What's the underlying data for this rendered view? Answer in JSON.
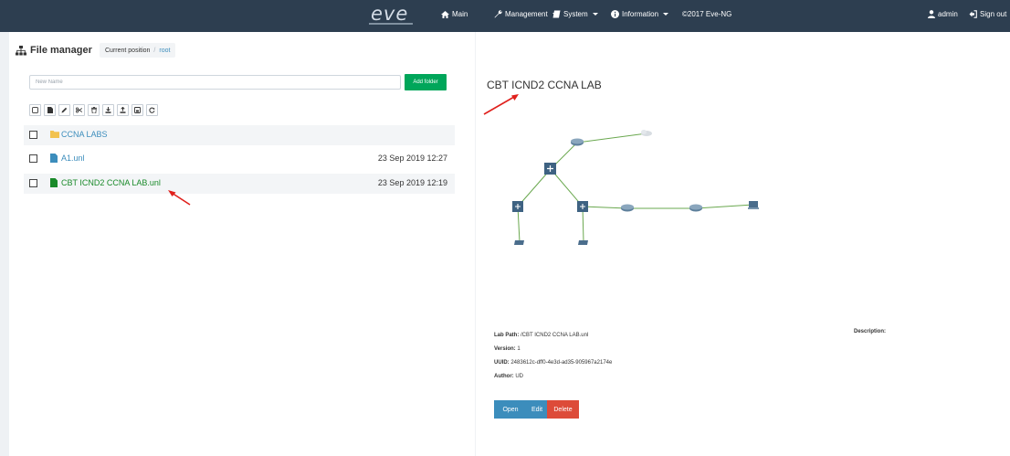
{
  "navbar": {
    "logo_text": "eve",
    "items": [
      {
        "label": "Main",
        "icon": "home-icon"
      },
      {
        "label": "Management",
        "icon": "wrench-icon"
      },
      {
        "label": "System",
        "icon": "book-icon"
      },
      {
        "label": "Information",
        "icon": "info-icon"
      },
      {
        "label": "©2017 Eve-NG"
      }
    ],
    "user": {
      "label": "admin",
      "icon": "user-icon"
    },
    "signout": {
      "label": "Sign out",
      "icon": "signout-icon"
    },
    "colors": {
      "background": "#2d3e50",
      "text": "#ffffff"
    }
  },
  "file_manager": {
    "title": "File manager",
    "icon": "sitemap-icon",
    "breadcrumb": {
      "label": "Current position",
      "separator": "/",
      "root": "root"
    },
    "new_name_placeholder": "New Name",
    "add_folder_label": "Add folder",
    "toolbar_icons": [
      "select-all-icon",
      "new-file-icon",
      "rename-icon",
      "cut-icon",
      "delete-icon",
      "import-icon",
      "export-icon",
      "save-icon",
      "refresh-icon"
    ],
    "items": [
      {
        "type": "folder",
        "name": "CCNA LABS",
        "date": "",
        "icon": "folder-icon"
      },
      {
        "type": "file",
        "name": "A1.unl",
        "date": "23 Sep 2019 12:27",
        "icon": "file-icon"
      },
      {
        "type": "file",
        "name": "CBT ICND2 CCNA LAB.unl",
        "date": "23 Sep 2019 12:19",
        "icon": "file-icon",
        "selected": true
      }
    ]
  },
  "lab": {
    "title": "CBT ICND2 CCNA LAB",
    "path_label": "Lab Path:",
    "path": "/CBT ICND2 CCNA LAB.unl",
    "version_label": "Version:",
    "version": "1",
    "uuid_label": "UUID:",
    "uuid": "2483612c-dff0-4e3d-ad35-905967a2174e",
    "author_label": "Author:",
    "author": "UD",
    "description_label": "Description:",
    "buttons": {
      "open": "Open",
      "edit": "Edit",
      "delete": "Delete"
    }
  },
  "colors": {
    "accent": "#3c8dbc",
    "success": "#00a65a",
    "danger": "#dd4b39",
    "selected_file": "#1a8a2a",
    "annotation": "#e0201c",
    "topology_link": "#6aa84f"
  }
}
